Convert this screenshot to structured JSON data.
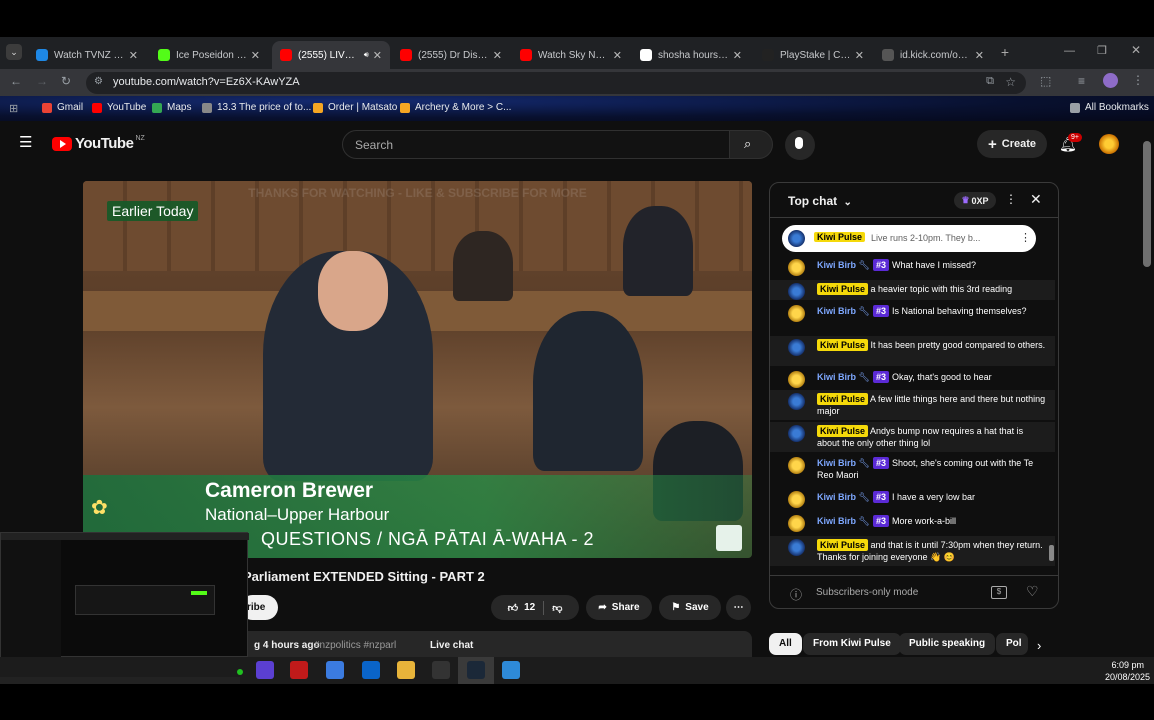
{
  "browser": {
    "tabs": [
      {
        "title": "Watch TVNZ 1 - F",
        "color": "#1e88e5",
        "active": false
      },
      {
        "title": "Ice Poseidon Stre",
        "color": "#53fc18",
        "active": false
      },
      {
        "title": "(2555) LIVE: 2",
        "color": "#ff0000",
        "active": true
      },
      {
        "title": "(2555) Dr Disres",
        "color": "#ff0000",
        "active": false
      },
      {
        "title": "Watch Sky News",
        "color": "#ff0000",
        "active": false
      },
      {
        "title": "shosha hours tim",
        "color": "#ffffff",
        "active": false
      },
      {
        "title": "PlayStake | Claim",
        "color": "#222222",
        "active": false
      },
      {
        "title": "id.kick.com/oauth",
        "color": "#555555",
        "active": false
      }
    ],
    "url": "youtube.com/watch?v=Ez6X-KAwYZA",
    "bookmarks": [
      {
        "label": "Gmail",
        "color": "#ea4335"
      },
      {
        "label": "YouTube",
        "color": "#ff0000"
      },
      {
        "label": "Maps",
        "color": "#34a853"
      },
      {
        "label": "13.3 The price of to...",
        "color": "#888888"
      },
      {
        "label": "Order | Matsato",
        "color": "#f5a623"
      },
      {
        "label": "Archery & More > C...",
        "color": "#f5a623"
      }
    ],
    "all_bookmarks": "All Bookmarks"
  },
  "youtube": {
    "logo": "YouTube",
    "region": "NZ",
    "search_placeholder": "Search",
    "create_label": "Create",
    "notifications_count": "9+",
    "video": {
      "overlay_tag": "Earlier Today",
      "banner_text": "THANKS FOR WATCHING - LIKE & SUBSCRIBE FOR MORE",
      "speaker_name": "Cameron Brewer",
      "speaker_role": "National–Upper Harbour",
      "segment": "QUESTIONS / NGĀ PĀTAI Ā-WAHA - 2"
    },
    "title": "Parliament EXTENDED Sitting - PART 2",
    "subscribe_label": "ribe",
    "likes": "12",
    "share_label": "Share",
    "save_label": "Save",
    "meta_time": "g 4 hours ago",
    "hashtags": "#nzpolitics #nzparl",
    "live_chat_label": "Live chat",
    "chips": [
      "All",
      "From Kiwi Pulse",
      "Public speaking",
      "Pol"
    ]
  },
  "chat": {
    "header": "Top chat",
    "points": "0XP",
    "pinned": {
      "name": "Kiwi Pulse",
      "text": "Live runs 2-10pm. They b..."
    },
    "messages": [
      {
        "name": "Kiwi Birb",
        "owner": false,
        "rank": "#3",
        "text": "What have I missed?"
      },
      {
        "name": "Kiwi Pulse",
        "owner": true,
        "rank": "",
        "text": "a heavier topic with this 3rd reading"
      },
      {
        "name": "Kiwi Birb",
        "owner": false,
        "rank": "#3",
        "text": "Is National behaving themselves?"
      },
      {
        "name": "Kiwi Pulse",
        "owner": true,
        "rank": "",
        "text": "It has been pretty good compared to others."
      },
      {
        "name": "Kiwi Birb",
        "owner": false,
        "rank": "#3",
        "text": "Okay, that's good to hear"
      },
      {
        "name": "Kiwi Pulse",
        "owner": true,
        "rank": "",
        "text": "A few little things here and there but nothing major"
      },
      {
        "name": "Kiwi Pulse",
        "owner": true,
        "rank": "",
        "text": "Andys bump now requires a hat that is about the only other thing lol"
      },
      {
        "name": "Kiwi Birb",
        "owner": false,
        "rank": "#3",
        "text": "Shoot, she's coming out with the Te Reo Maori"
      },
      {
        "name": "Kiwi Birb",
        "owner": false,
        "rank": "#3",
        "text": "I have a very low bar"
      },
      {
        "name": "Kiwi Birb",
        "owner": false,
        "rank": "#3",
        "text": "More work-a-bill"
      },
      {
        "name": "Kiwi Pulse",
        "owner": true,
        "rank": "",
        "text": "and that is it until 7:30pm when they return. Thanks for joining everyone 👋 😊"
      }
    ],
    "input_placeholder": "Subscribers-only mode"
  },
  "taskbar": {
    "time": "6:09 pm",
    "date": "20/08/2025"
  }
}
